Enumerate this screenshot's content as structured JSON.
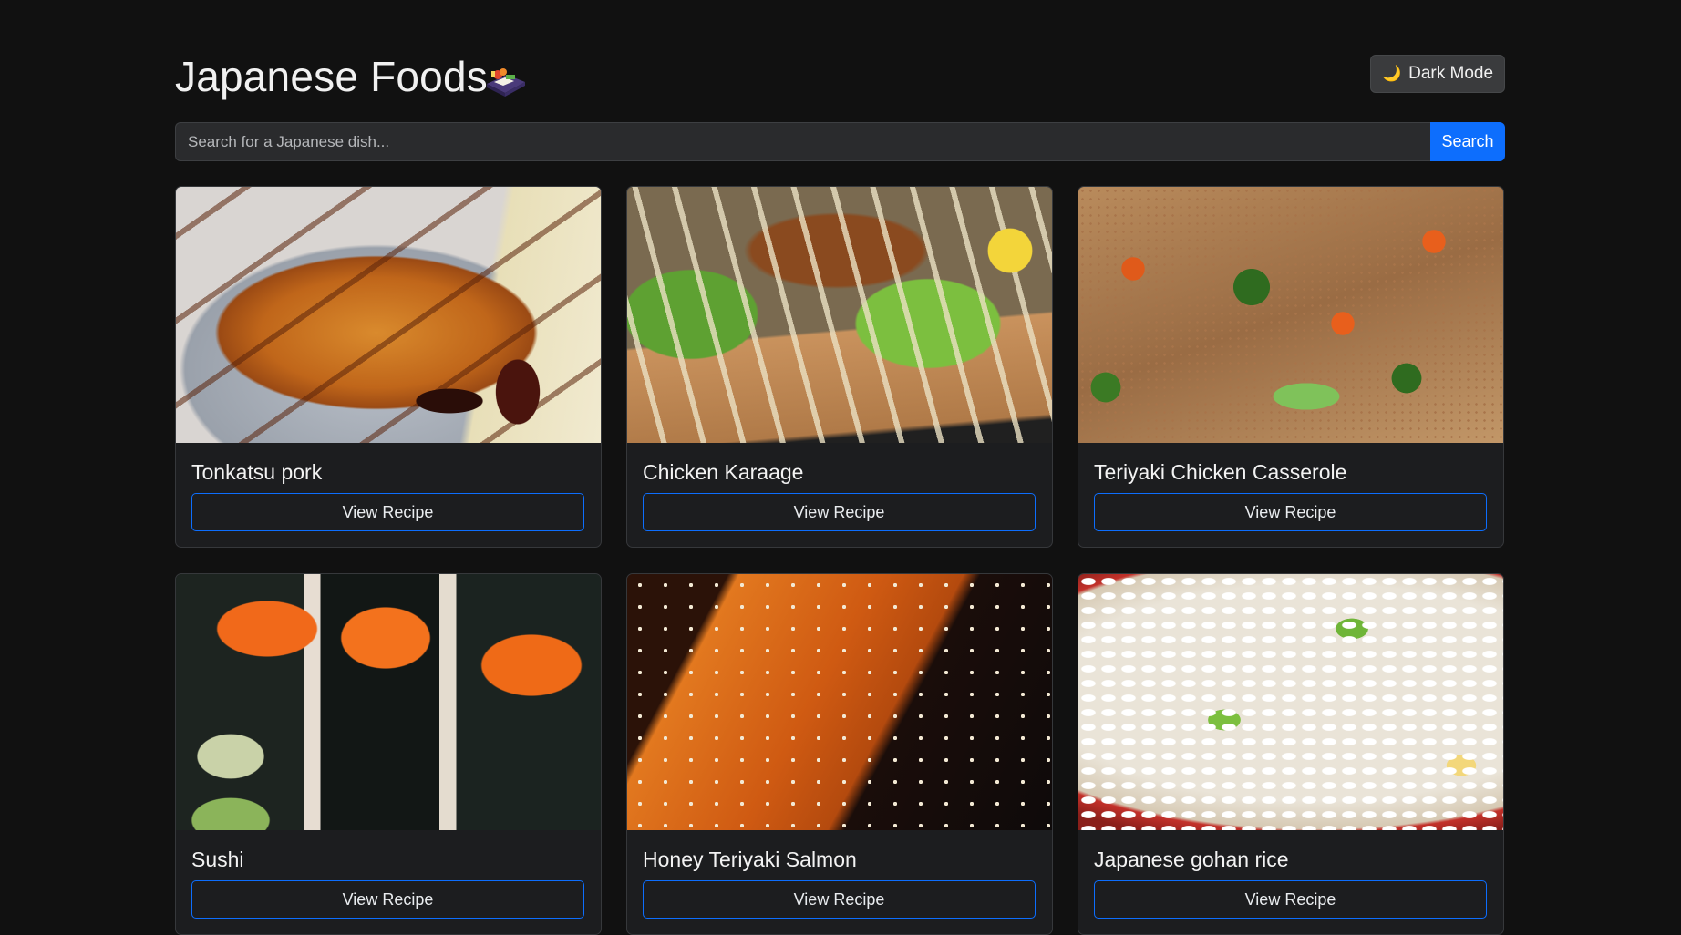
{
  "header": {
    "title": "Japanese Foods",
    "title_icon": "bento-box-icon",
    "theme_toggle": {
      "icon": "moon-icon",
      "icon_glyph": "🌙",
      "label": "Dark Mode"
    }
  },
  "search": {
    "placeholder": "Search for a Japanese dish...",
    "value": "",
    "button_label": "Search"
  },
  "colors": {
    "background": "#111111",
    "card_bg": "#1c1d1f",
    "primary": "#0d6efd",
    "text": "#e9ecef"
  },
  "dishes": [
    {
      "name": "Tonkatsu pork",
      "button_label": "View Recipe"
    },
    {
      "name": "Chicken Karaage",
      "button_label": "View Recipe"
    },
    {
      "name": "Teriyaki Chicken Casserole",
      "button_label": "View Recipe"
    },
    {
      "name": "Sushi",
      "button_label": "View Recipe"
    },
    {
      "name": "Honey Teriyaki Salmon",
      "button_label": "View Recipe"
    },
    {
      "name": "Japanese gohan rice",
      "button_label": "View Recipe"
    }
  ]
}
